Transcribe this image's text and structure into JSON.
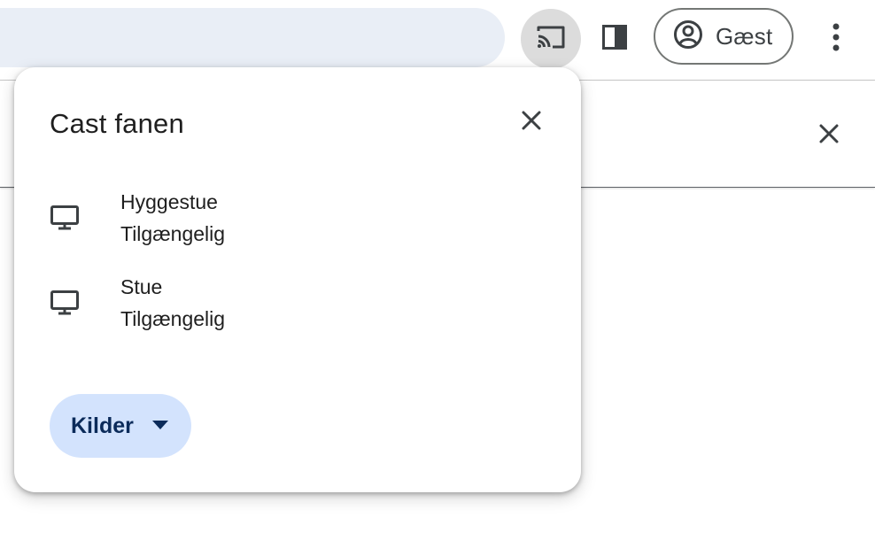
{
  "toolbar": {
    "profile_label": "Gæst"
  },
  "dialog": {
    "title": "Cast fanen",
    "sinks": [
      {
        "name": "Hyggestue",
        "status": "Tilgængelig"
      },
      {
        "name": "Stue",
        "status": "Tilgængelig"
      }
    ],
    "sources_label": "Kilder"
  },
  "colors": {
    "accent_button": "#d3e3fd",
    "accent_text": "#0b2b5a",
    "omnibox": "#e9eef6",
    "icon": "#3c4043"
  }
}
